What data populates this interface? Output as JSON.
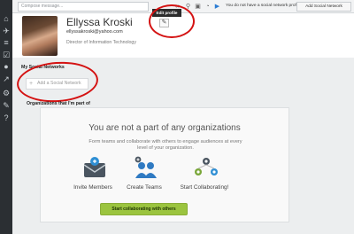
{
  "topbar": {
    "compose_placeholder": "Compose message...",
    "no_network_text": "You do not have a social network profile set.",
    "add_network_button": "Add Social Network"
  },
  "profile": {
    "name": "Ellyssa Kroski",
    "email": "ellyssakroski@yahoo.com",
    "title": "Director of Information Technology",
    "edit_tooltip": "Edit profile"
  },
  "social": {
    "heading": "My Social Networks",
    "add_label": "Add a Social Network"
  },
  "organizations": {
    "heading": "Organizations that I'm part of",
    "panel_title": "You are not a part of any organizations",
    "description": "Form teams and collaborate with others to engage audiences at every level of your organization.",
    "features": [
      {
        "label": "Invite Members",
        "icon": "invite-envelope-icon"
      },
      {
        "label": "Create Teams",
        "icon": "team-icon"
      },
      {
        "label": "Start Collaborating!",
        "icon": "collaboration-icon"
      }
    ],
    "cta_label": "Start collaborating with others"
  },
  "colors": {
    "sidebar": "#2b2f33",
    "annotation": "#d41212",
    "cta": "#9bc43f"
  }
}
